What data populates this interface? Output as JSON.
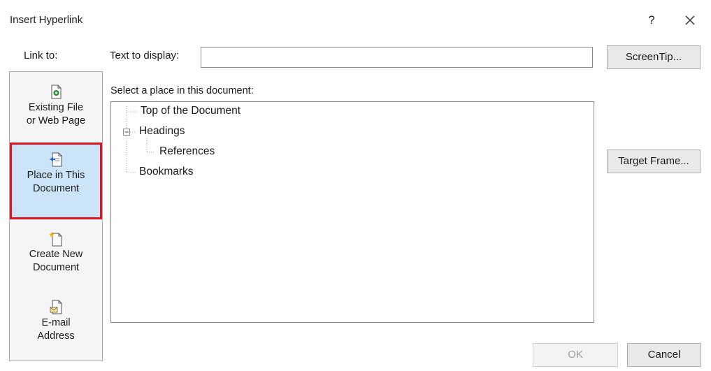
{
  "dialog": {
    "title": "Insert Hyperlink",
    "help_label": "?"
  },
  "link_to": {
    "label": "Link to:",
    "items": [
      {
        "id": "existing",
        "line1": "Existing File",
        "line2": "or Web Page",
        "icon": "existing-file-icon",
        "selected": false
      },
      {
        "id": "place",
        "line1": "Place in This",
        "line2": "Document",
        "icon": "place-in-document-icon",
        "selected": true
      },
      {
        "id": "create",
        "line1": "Create New",
        "line2": "Document",
        "icon": "create-new-document-icon",
        "selected": false
      },
      {
        "id": "email",
        "line1": "E-mail",
        "line2": "Address",
        "icon": "email-address-icon",
        "selected": false
      }
    ]
  },
  "text_to_display": {
    "label": "Text to display:",
    "value": ""
  },
  "buttons": {
    "screentip": "ScreenTip...",
    "target_frame": "Target Frame...",
    "ok": "OK",
    "cancel": "Cancel"
  },
  "place": {
    "label": "Select a place in this document:",
    "tree": [
      {
        "label": "Top of the Document",
        "level": 0
      },
      {
        "label": "Headings",
        "level": 0,
        "expanded": true
      },
      {
        "label": "References",
        "level": 1
      },
      {
        "label": "Bookmarks",
        "level": 0
      }
    ]
  },
  "colors": {
    "selection_highlight": "#cce4f7",
    "callout_border": "#e0141e",
    "disabled_text": "#9c9c9c"
  }
}
